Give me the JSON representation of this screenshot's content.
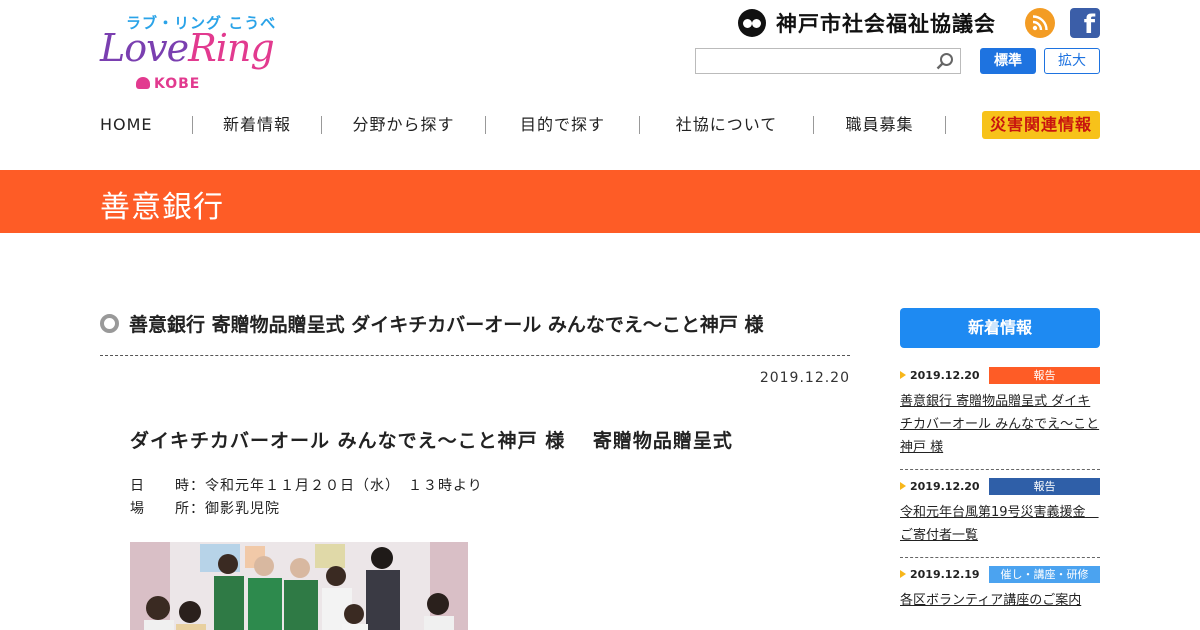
{
  "header": {
    "logo_top": "ラブ・リング こうべ",
    "logo_main_a": "Love",
    "logo_main_b": "Ring",
    "logo_kobe": "KOBE",
    "org_name": "神戸市社会福祉協議会",
    "fb_letter": "f",
    "search_placeholder": "",
    "font_standard": "標準",
    "font_large": "拡大"
  },
  "nav": {
    "items": [
      "HOME",
      "新着情報",
      "分野から探す",
      "目的で探す",
      "社協について",
      "職員募集"
    ],
    "disaster": "災害関連情報"
  },
  "banner": {
    "title": "善意銀行"
  },
  "article": {
    "title": "善意銀行 寄贈物品贈呈式 ダイキチカバーオール みんなでえ～こと神戸 様",
    "date": "2019.12.20",
    "subtitle": "ダイキチカバーオール みんなでえ～こと神戸 様　 寄贈物品贈呈式",
    "line1": "日　　時：令和元年１１月２０日（水）　１３時より",
    "line2": "場　　所：御影乳児院"
  },
  "sidebar": {
    "heading": "新着情報",
    "news": [
      {
        "date": "2019.12.20",
        "tag": "報告",
        "tag_color": "#fe5c26",
        "text": "善意銀行 寄贈物品贈呈式 ダイキチカバーオール みんなでえ～こと神戸 様"
      },
      {
        "date": "2019.12.20",
        "tag": "報告",
        "tag_color": "#2f5fa8",
        "text": "令和元年台風第19号災害義援金　ご寄付者一覧"
      },
      {
        "date": "2019.12.19",
        "tag": "催し・講座・研修",
        "tag_color": "#4ba3f0",
        "text": "各区ボランティア講座のご案内"
      }
    ]
  },
  "colors": {
    "accent": "#fe5c26",
    "brand_blue": "#1e8af2"
  }
}
